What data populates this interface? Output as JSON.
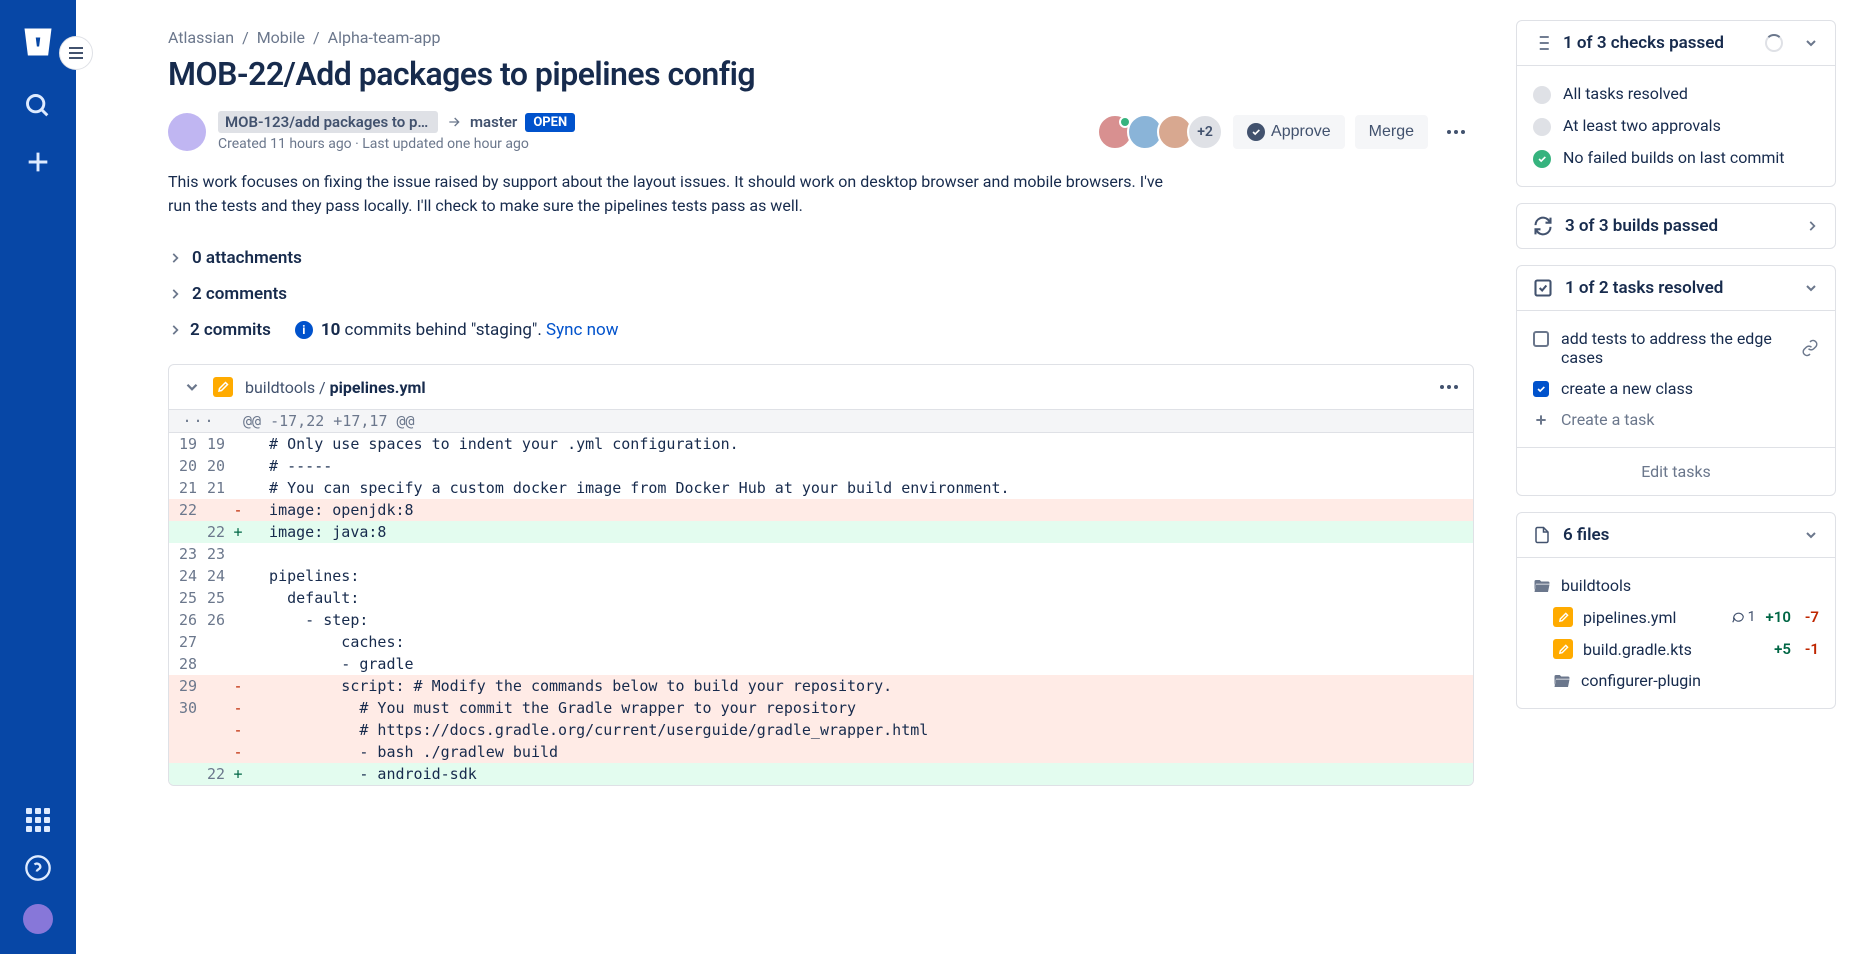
{
  "breadcrumb": [
    "Atlassian",
    "Mobile",
    "Alpha-team-app"
  ],
  "title": "MOB-22/Add packages to pipelines config",
  "pr": {
    "source_branch": "MOB-123/add packages to pi...",
    "target_branch": "master",
    "status": "OPEN",
    "created": "Created 11 hours ago · Last updated one hour ago",
    "extra_reviewers": "+2",
    "approve_label": "Approve",
    "merge_label": "Merge"
  },
  "description": "This work focuses on fixing the issue raised by support about the layout issues. It should work on desktop browser and mobile browsers. I've run the tests and they pass locally. I'll check to make sure the pipelines tests pass as well.",
  "sections": {
    "attachments": "0 attachments",
    "comments": "2 comments",
    "commits_label": "2 commits",
    "commits_behind_count": "10",
    "commits_behind_text": " commits behind \"staging\". ",
    "sync_label": "Sync now"
  },
  "diff": {
    "path_prefix": "buildtools / ",
    "filename": "pipelines.yml",
    "hunk_header": "@@ -17,22 +17,17 @@",
    "lines": [
      {
        "old": "19",
        "new": "19",
        "type": "ctx",
        "text": "  # Only use spaces to indent your .yml configuration."
      },
      {
        "old": "20",
        "new": "20",
        "type": "ctx",
        "text": "  # -----"
      },
      {
        "old": "21",
        "new": "21",
        "type": "ctx",
        "text": "  # You can specify a custom docker image from Docker Hub at your build environment."
      },
      {
        "old": "22",
        "new": "",
        "type": "del",
        "text": "  image: openjdk:8"
      },
      {
        "old": "",
        "new": "22",
        "type": "add",
        "text": "  image: java:8"
      },
      {
        "old": "23",
        "new": "23",
        "type": "ctx",
        "text": ""
      },
      {
        "old": "24",
        "new": "24",
        "type": "ctx",
        "text": "  pipelines:"
      },
      {
        "old": "25",
        "new": "25",
        "type": "ctx",
        "text": "    default:"
      },
      {
        "old": "26",
        "new": "26",
        "type": "ctx",
        "text": "      - step:"
      },
      {
        "old": "27",
        "new": "",
        "type": "ctx",
        "text": "          caches:"
      },
      {
        "old": "28",
        "new": "",
        "type": "ctx",
        "text": "          - gradle"
      },
      {
        "old": "29",
        "new": "",
        "type": "del",
        "text": "          script: # Modify the commands below to build your repository."
      },
      {
        "old": "30",
        "new": "",
        "type": "del",
        "text": "            # You must commit the Gradle wrapper to your repository"
      },
      {
        "old": "",
        "new": "",
        "type": "del",
        "text": "            # https://docs.gradle.org/current/userguide/gradle_wrapper.html"
      },
      {
        "old": "",
        "new": "",
        "type": "del",
        "text": "            - bash ./gradlew build"
      },
      {
        "old": "",
        "new": "22",
        "type": "add",
        "text": "            - android-sdk"
      }
    ]
  },
  "side": {
    "checks_header": "1 of 3 checks passed",
    "checks": [
      {
        "status": "neutral",
        "text": "All tasks resolved"
      },
      {
        "status": "neutral",
        "text": "At least two approvals"
      },
      {
        "status": "success",
        "text": "No failed builds on last commit"
      }
    ],
    "builds_header": "3 of 3 builds passed",
    "tasks_header": "1 of 2 tasks resolved",
    "tasks": [
      {
        "checked": false,
        "text": "add tests to address the edge cases",
        "link": true
      },
      {
        "checked": true,
        "text": "create a new class"
      }
    ],
    "create_task": "Create a task",
    "edit_tasks": "Edit tasks",
    "files_header": "6 files",
    "files": {
      "folder1": "buildtools",
      "file1": {
        "name": "pipelines.yml",
        "comments": "1",
        "add": "+10",
        "del": "-7"
      },
      "file2": {
        "name": "build.gradle.kts",
        "add": "+5",
        "del": "-1"
      },
      "folder2": "configurer-plugin"
    }
  }
}
